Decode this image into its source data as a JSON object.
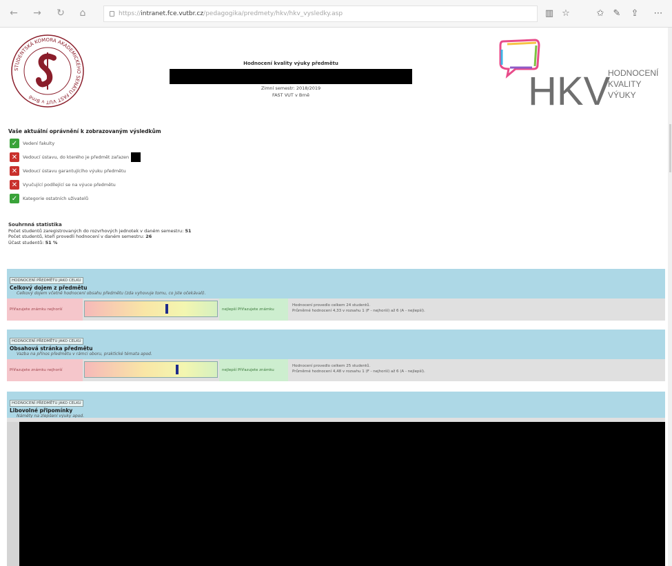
{
  "browser": {
    "url_prefix": "https://",
    "url_host": "intranet.fce.vutbr.cz",
    "url_path": "/pedagogika/predmety/hkv/hkv_vysledky.asp",
    "icons": [
      "back-icon",
      "forward-icon",
      "refresh-icon",
      "home-icon",
      "lock-icon",
      "reading-view-icon",
      "favorite-star-icon",
      "favorites-icon",
      "pen-icon",
      "share-icon",
      "more-icon"
    ]
  },
  "header": {
    "seal_text": "STUDENTSKÁ KOMORA AKADEMICKÉHO SENÁTU FAST VUT v Brně",
    "seal_letter": "S",
    "title": "Hodnocení kvality výuky předmětu",
    "semester": "Zimní semestr: 2018/2019",
    "faculty": "FAST VUT v Brně",
    "logo_text": "HKV",
    "logo_sub": [
      "HODNOCENÍ",
      "KVALITY",
      "VÝUKY"
    ]
  },
  "permissions": {
    "title": "Vaše aktuální oprávnění k zobrazovaným výsledkům",
    "items": [
      {
        "label": "Vedení fakulty",
        "ok": true
      },
      {
        "label": "Vedoucí ústavu, do kterého je předmět zařazen",
        "ok": false,
        "redacted": true
      },
      {
        "label": "Vedoucí ústavu garantujícího výuku předmětu",
        "ok": false
      },
      {
        "label": "Vyučující podílející se na výuce předmětu",
        "ok": false
      },
      {
        "label": "Kategorie ostatních uživatelů",
        "ok": true
      }
    ]
  },
  "stats": {
    "title": "Souhrnná statistika",
    "line1_label": "Počet studentů zaregistrovaných do rozvrhových jednotek v daném semestru:",
    "line1_value": "51",
    "line2_label": "Počet studentů, kteří provedli hodnocení v daném semestru:",
    "line2_value": "26",
    "line3_label": "Účast studentů:",
    "line3_value": "51 %"
  },
  "panels": [
    {
      "tag": "HODNOCENÍ PŘEDMĚTU JAKO CELKU",
      "title": "Celkový dojem z předmětu",
      "desc": "Celkový dojem včetně hodnocení obsahu předmětu (zda vyhovuje tomu, co jste očekávali).",
      "left_label": "Přiřazujete známku nejhorší",
      "right_label": "nejlepší Přiřazujete známku",
      "info1": "Hodnocení provedlo celkem 24 studentů.",
      "info2": "Průměrné hodnocení 4,33 v rozsahu 1 (F - nejhorší) až 6 (A - nejlepší).",
      "gauge_fraction": 0.62
    },
    {
      "tag": "HODNOCENÍ PŘEDMĚTU JAKO CELKU",
      "title": "Obsahová stránka předmětu",
      "desc": "Vazba na přínos předmětu v rámci oboru, praktické témata apod.",
      "left_label": "Přiřazujete známku nejhorší",
      "right_label": "nejlepší Přiřazujete známku",
      "info1": "Hodnocení provedlo celkem 25 studentů.",
      "info2": "Průměrné hodnocení 4,48 v rozsahu 1 (F - nejhorší) až 6 (A - nejlepší).",
      "gauge_fraction": 0.7
    },
    {
      "tag": "HODNOCENÍ PŘEDMĚTU JAKO CELKU",
      "title": "Libovolné připomínky",
      "desc": "Náměty na zlepšení výuky apod."
    }
  ]
}
